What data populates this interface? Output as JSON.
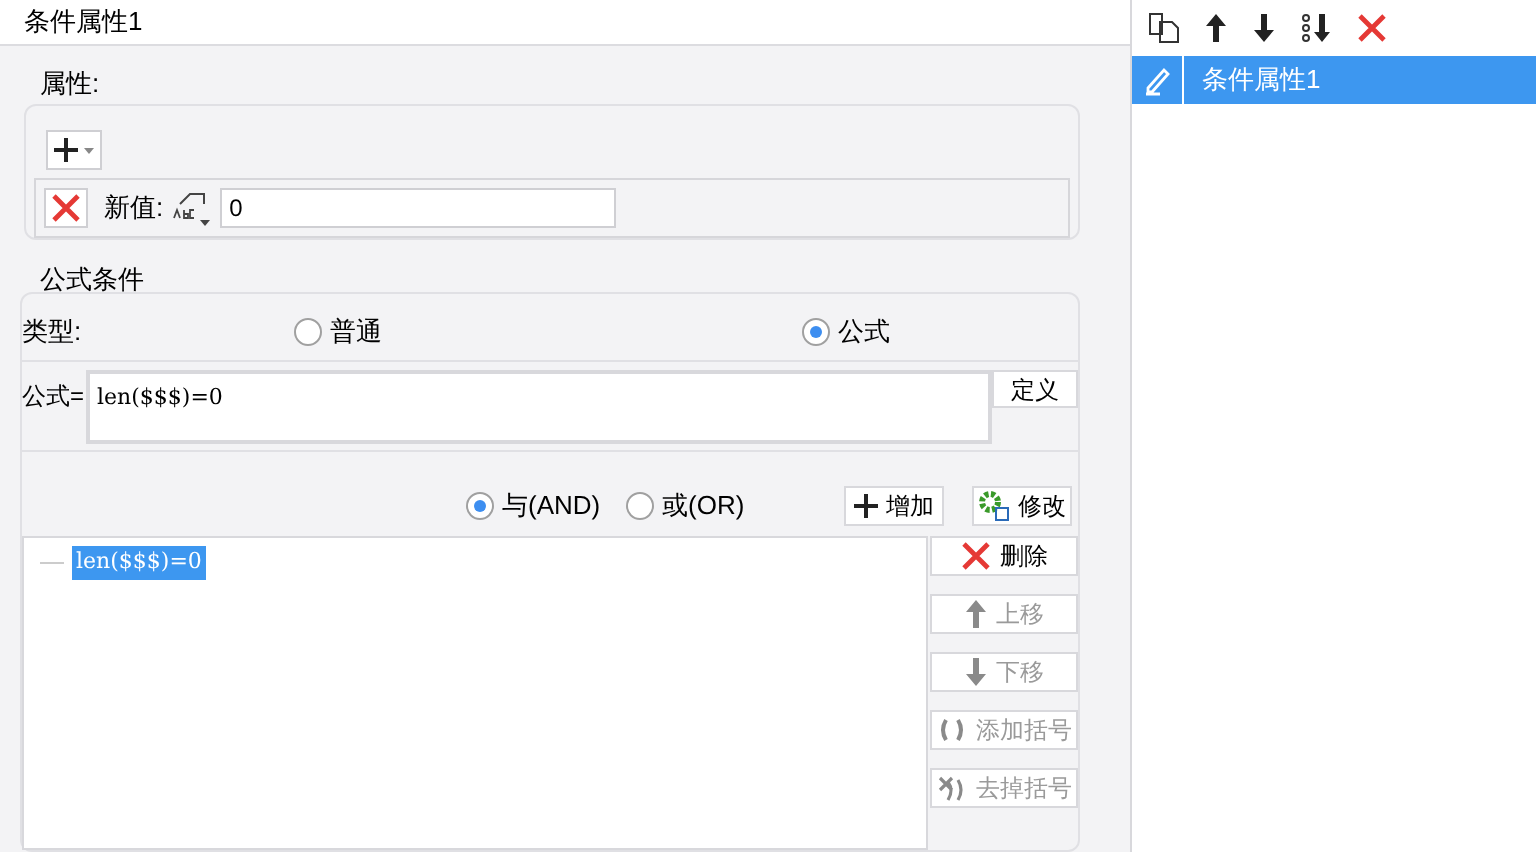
{
  "title": "条件属性1",
  "properties": {
    "label": "属性:",
    "new_value_label": "新值:",
    "new_value": "0"
  },
  "formula_condition": {
    "label": "公式条件",
    "type_label": "类型:",
    "types": [
      {
        "label": "普通",
        "selected": false
      },
      {
        "label": "公式",
        "selected": true
      }
    ],
    "formula_label": "公式=",
    "formula": "len($$$)=0",
    "define_button": "定义",
    "logic": [
      {
        "label": "与(AND)",
        "selected": true
      },
      {
        "label": "或(OR)",
        "selected": false
      }
    ],
    "add_button": "增加",
    "modify_button": "修改",
    "conditions": [
      {
        "text": "len($$$)=0",
        "selected": true
      }
    ],
    "actions": [
      {
        "kind": "delete",
        "label": "删除",
        "disabled": false
      },
      {
        "kind": "up",
        "label": "上移",
        "disabled": true
      },
      {
        "kind": "down",
        "label": "下移",
        "disabled": true
      },
      {
        "kind": "add-bracket",
        "label": "添加括号",
        "disabled": true
      },
      {
        "kind": "remove-bracket",
        "label": "去掉括号",
        "disabled": true
      }
    ]
  },
  "side_list": {
    "items": [
      {
        "label": "条件属性1",
        "selected": true
      }
    ]
  }
}
